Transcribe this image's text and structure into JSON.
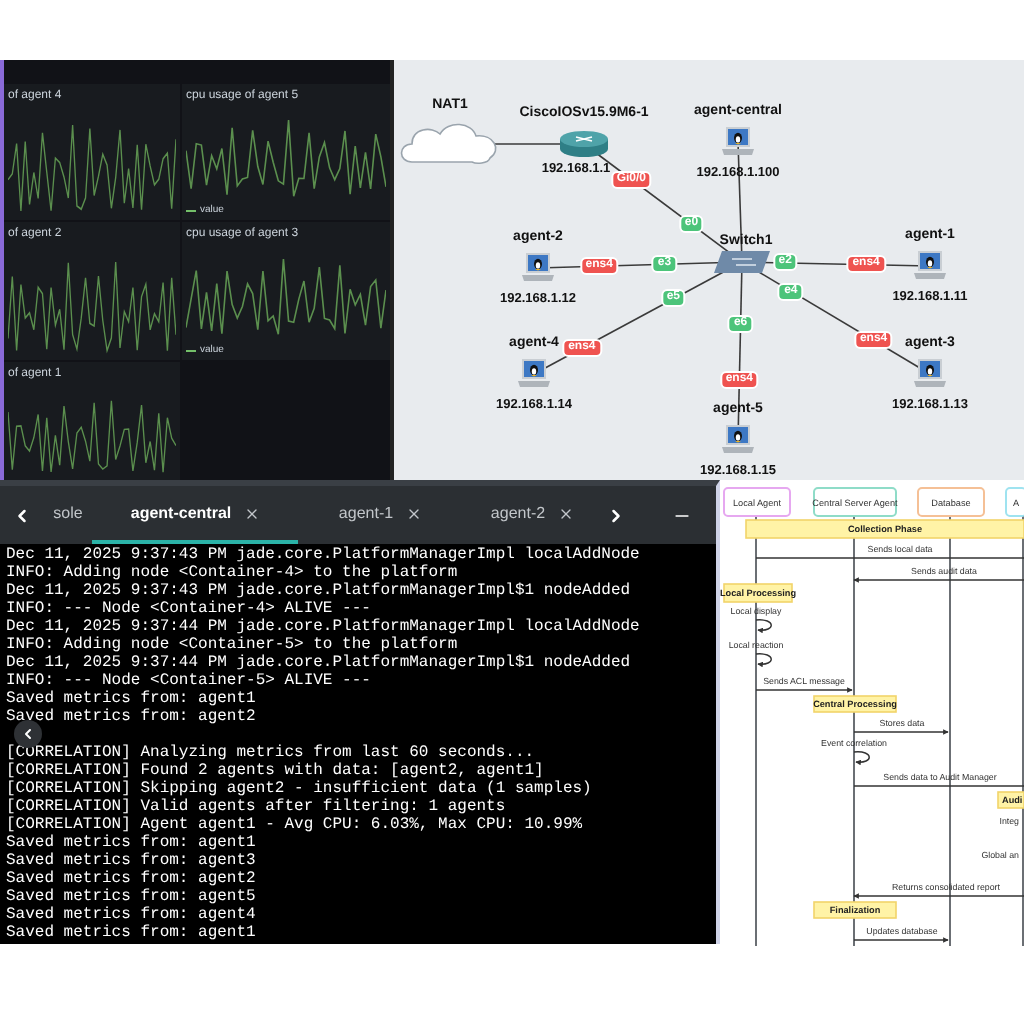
{
  "dashboard": {
    "panels": [
      {
        "title": "of agent 4"
      },
      {
        "title": "cpu usage of agent 5",
        "legend": "value"
      },
      {
        "title": "of agent 2"
      },
      {
        "title": "cpu usage of agent 3",
        "legend": "value"
      },
      {
        "title": "of agent 1"
      }
    ]
  },
  "network": {
    "nodes": [
      {
        "name": "NAT1",
        "kind": "cloud"
      },
      {
        "name": "CiscoIOSv15.9M6-1",
        "kind": "router",
        "ip": "192.168.1.1"
      },
      {
        "name": "agent-central",
        "kind": "host",
        "ip": "192.168.1.100"
      },
      {
        "name": "agent-2",
        "kind": "host",
        "ip": "192.168.1.12"
      },
      {
        "name": "Switch1",
        "kind": "switch"
      },
      {
        "name": "agent-1",
        "kind": "host",
        "ip": "192.168.1.11"
      },
      {
        "name": "agent-4",
        "kind": "host",
        "ip": "192.168.1.14"
      },
      {
        "name": "agent-3",
        "kind": "host",
        "ip": "192.168.1.13"
      },
      {
        "name": "agent-5",
        "kind": "host",
        "ip": "192.168.1.15"
      }
    ],
    "links": [
      {
        "ports": [
          {
            "label": "Gi0/0",
            "color": "#ef5350"
          },
          {
            "label": "e0",
            "color": "#4cc47a"
          }
        ]
      },
      {
        "ports": [
          {
            "label": "ens4",
            "color": "#ef5350"
          },
          {
            "label": "e3",
            "color": "#4cc47a"
          }
        ]
      },
      {
        "ports": [
          {
            "label": "e2",
            "color": "#4cc47a"
          },
          {
            "label": "ens4",
            "color": "#ef5350"
          }
        ]
      },
      {
        "ports": [
          {
            "label": "ens4",
            "color": "#ef5350"
          },
          {
            "label": "e5",
            "color": "#4cc47a"
          }
        ]
      },
      {
        "ports": [
          {
            "label": "ens4",
            "color": "#ef5350"
          },
          {
            "label": "e4",
            "color": "#4cc47a"
          }
        ]
      },
      {
        "ports": [
          {
            "label": "e6",
            "color": "#4cc47a"
          },
          {
            "label": "ens4",
            "color": "#ef5350"
          }
        ]
      }
    ]
  },
  "terminal": {
    "tabs": [
      {
        "label": "sole",
        "selected": false,
        "closable": false
      },
      {
        "label": "agent-central",
        "selected": true,
        "closable": true
      },
      {
        "label": "agent-1",
        "selected": false,
        "closable": true
      },
      {
        "label": "agent-2",
        "selected": false,
        "closable": true
      }
    ],
    "blocks": [
      [
        "Dec 11, 2025 9:37:43 PM jade.core.PlatformManagerImpl localAddNode",
        "INFO: Adding node <Container-4> to the platform",
        "Dec 11, 2025 9:37:43 PM jade.core.PlatformManagerImpl$1 nodeAdded",
        "INFO: --- Node <Container-4> ALIVE ---",
        "Dec 11, 2025 9:37:44 PM jade.core.PlatformManagerImpl localAddNode",
        "INFO: Adding node <Container-5> to the platform",
        "Dec 11, 2025 9:37:44 PM jade.core.PlatformManagerImpl$1 nodeAdded",
        "INFO: --- Node <Container-5> ALIVE ---",
        "Saved metrics from: agent1",
        "Saved metrics from: agent2"
      ],
      [
        "[CORRELATION] Analyzing metrics from last 60 seconds...",
        "[CORRELATION] Found 2 agents with data: [agent2, agent1]",
        "[CORRELATION] Skipping agent2 - insufficient data (1 samples)",
        "[CORRELATION] Valid agents after filtering: 1 agents",
        "[CORRELATION] Agent agent1 - Avg CPU: 6.03%, Max CPU: 10.99%",
        "Saved metrics from: agent1",
        "Saved metrics from: agent3",
        "Saved metrics from: agent2",
        "Saved metrics from: agent5",
        "Saved metrics from: agent4",
        "Saved metrics from: agent1"
      ]
    ]
  },
  "sequence": {
    "participants": [
      {
        "name": "Local Agent",
        "color": "#e6a8f0"
      },
      {
        "name": "Central Server Agent",
        "color": "#8fdcc8"
      },
      {
        "name": "Database",
        "color": "#f5c096"
      },
      {
        "name": "A",
        "color": "#9fe3f0"
      }
    ],
    "notes": [
      "Collection Phase",
      "Local Processing",
      "Central Processing",
      "Audi",
      "Finalization"
    ],
    "messages": [
      {
        "kind": "arrow",
        "text": "Sends local data"
      },
      {
        "kind": "arrow",
        "text": "Sends audit data"
      },
      {
        "kind": "self",
        "text": "Local display"
      },
      {
        "kind": "self",
        "text": "Local reaction"
      },
      {
        "kind": "arrow",
        "text": "Sends ACL message"
      },
      {
        "kind": "arrow",
        "text": "Stores data"
      },
      {
        "kind": "self",
        "text": "Event correlation"
      },
      {
        "kind": "arrow",
        "text": "Sends data to Audit Manager"
      },
      {
        "kind": "label",
        "text": "Integ"
      },
      {
        "kind": "label",
        "text": "Global an"
      },
      {
        "kind": "arrow",
        "text": "Returns consolidated report"
      },
      {
        "kind": "arrow",
        "text": "Updates database"
      }
    ]
  }
}
